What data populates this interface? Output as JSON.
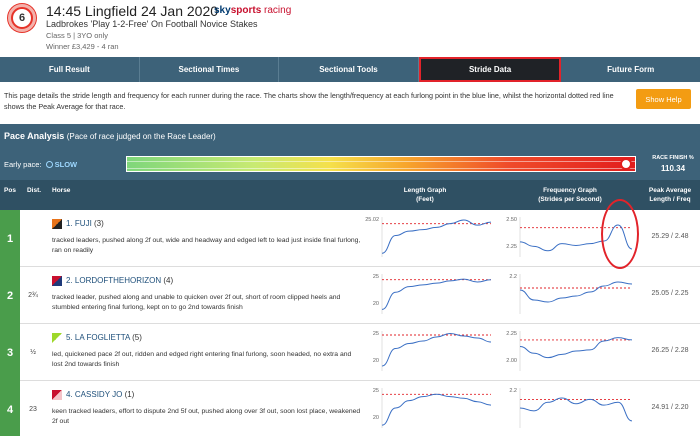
{
  "header": {
    "race_number": "6",
    "title": "14:45 Lingfield 24 Jan 2020",
    "logo": {
      "sky": "sky",
      "sports": "sports",
      "racing": "racing"
    },
    "race_name": "Ladbrokes 'Play 1-2-Free' On Football Novice Stakes",
    "race_class": "Class 5 | 3YO only",
    "winner_info": "Winner £3,429 - 4 ran"
  },
  "tabs": [
    {
      "label": "Full Result",
      "active": false
    },
    {
      "label": "Sectional Times",
      "active": false
    },
    {
      "label": "Sectional Tools",
      "active": false
    },
    {
      "label": "Stride Data",
      "active": true
    },
    {
      "label": "Future Form",
      "active": false
    }
  ],
  "description": "This page details the stride length and frequency for each runner during the race. The charts show the length/frequency at each furlong point in the blue line, whilst the horizontal dotted red line shows the Peak Average for that race.",
  "help_button": "Show Help",
  "pace": {
    "title": "Pace Analysis",
    "subtitle": "(Pace of race judged on the Race Leader)",
    "early_pace_label": "Early pace:",
    "early_pace_value": "SLOW",
    "finish_label": "RACE FINISH %",
    "finish_value": "110.34",
    "finish_fraction": 0.98
  },
  "columns": {
    "pos": "Pos",
    "dist": "Dist.",
    "horse": "Horse",
    "length_graph": "Length Graph",
    "length_unit": "(Feet)",
    "freq_graph": "Frequency Graph",
    "freq_unit": "(Strides per Second)",
    "peak": "Peak Average",
    "peak_unit": "Length / Freq"
  },
  "colors": {
    "header_bg": "#3d6279",
    "pos_bg": "#4a9d4b",
    "line": "#3a6fc4",
    "peak_line": "#e2232a",
    "highlight": "#e2232a"
  },
  "runners": [
    {
      "pos": "1",
      "dist": "",
      "number": "1.",
      "name": "FUJI",
      "draw": "(3)",
      "silk_colors": [
        "#e8731a",
        "#222"
      ],
      "comment": "tracked leaders, pushed along 2f out, wide and headway and edged left to lead just inside final furlong, ran on readily",
      "peak": "25.29 / 2.48",
      "length_ticks": [
        "25.02",
        ""
      ],
      "length_series": [
        21.0,
        23.4,
        24.0,
        24.2,
        24.5,
        25.0,
        25.5,
        24.8,
        25.2
      ],
      "length_peak": 25.0,
      "length_range": [
        20.5,
        25.9
      ],
      "freq_ticks": [
        "2.50",
        "2.25"
      ],
      "freq_series": [
        2.32,
        2.27,
        2.22,
        2.3,
        2.28,
        2.3,
        2.33,
        2.51,
        2.24
      ],
      "freq_peak": 2.48,
      "freq_range": [
        2.15,
        2.6
      ]
    },
    {
      "pos": "2",
      "dist": "2¾",
      "number": "2.",
      "name": "LORDOFTHEHORIZON",
      "draw": "(4)",
      "silk_colors": [
        "#c8102e",
        "#1f3a7a"
      ],
      "comment": "tracked leader, pushed along and unable to quicken over 2f out, short of room clipped heels and stumbled entering final furlong, kept on to go 2nd towards finish",
      "peak": "25.05 / 2.25",
      "length_ticks": [
        "25",
        "20"
      ],
      "length_series": [
        19.8,
        22.8,
        23.8,
        24.1,
        24.4,
        24.8,
        25.1,
        24.6,
        25.0
      ],
      "length_peak": 25.0,
      "length_range": [
        19.0,
        26.0
      ],
      "freq_ticks": [
        "2.2",
        ""
      ],
      "freq_series": [
        2.22,
        2.17,
        2.16,
        2.18,
        2.19,
        2.21,
        2.24,
        2.26,
        2.25
      ],
      "freq_peak": 2.23,
      "freq_range": [
        2.1,
        2.3
      ]
    },
    {
      "pos": "3",
      "dist": "½",
      "number": "5.",
      "name": "LA FOGLIETTA",
      "draw": "(5)",
      "silk_colors": [
        "#9ed82a",
        "#ffffff"
      ],
      "comment": "led, quickened pace 2f out, ridden and edged right entering final furlong, soon headed, no extra and lost 2nd towards finish",
      "peak": "26.25 / 2.28",
      "length_ticks": [
        "25",
        "20"
      ],
      "length_series": [
        20.0,
        23.5,
        24.5,
        25.0,
        25.8,
        26.5,
        26.0,
        25.6,
        24.8
      ],
      "length_peak": 26.2,
      "length_range": [
        19.0,
        27.0
      ],
      "freq_ticks": [
        "2.25",
        "2.00"
      ],
      "freq_series": [
        2.22,
        2.16,
        2.12,
        2.15,
        2.18,
        2.19,
        2.27,
        2.3,
        2.28
      ],
      "freq_peak": 2.28,
      "freq_range": [
        2.0,
        2.36
      ]
    },
    {
      "pos": "4",
      "dist": "23",
      "number": "4.",
      "name": "CASSIDY JO",
      "draw": "(1)",
      "silk_colors": [
        "#c8102e",
        "#f4c3c8"
      ],
      "comment": "keen tracked leaders, effort to dispute 2nd 5f out, pushed along over 3f out, soon lost place, weakened 2f out",
      "peak": "24.91 / 2.20",
      "length_ticks": [
        "25",
        "20"
      ],
      "length_series": [
        19.5,
        22.5,
        23.8,
        24.5,
        24.9,
        24.5,
        24.2,
        23.6,
        23.0
      ],
      "length_peak": 24.9,
      "length_range": [
        19.0,
        26.0
      ],
      "freq_ticks": [
        "2.2",
        ""
      ],
      "freq_series": [
        2.14,
        2.12,
        2.18,
        2.21,
        2.17,
        2.2,
        2.16,
        2.18,
        2.05
      ],
      "freq_peak": 2.2,
      "freq_range": [
        2.0,
        2.28
      ]
    }
  ]
}
